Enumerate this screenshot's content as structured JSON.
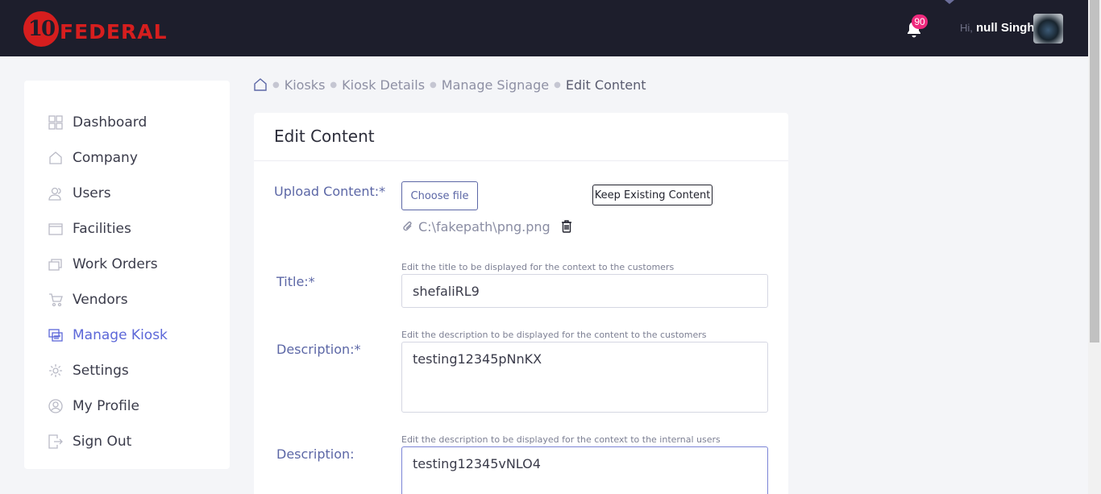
{
  "header": {
    "logo_number": "10",
    "logo_text": "FEDERAL",
    "notification_count": "90",
    "greeting": "Hi,",
    "user_name": "null Singh"
  },
  "sidebar": {
    "items": [
      {
        "label": "Dashboard",
        "icon": "dashboard-icon"
      },
      {
        "label": "Company",
        "icon": "home-icon"
      },
      {
        "label": "Users",
        "icon": "users-icon"
      },
      {
        "label": "Facilities",
        "icon": "facilities-icon"
      },
      {
        "label": "Work Orders",
        "icon": "work-orders-icon"
      },
      {
        "label": "Vendors",
        "icon": "cart-icon"
      },
      {
        "label": "Manage Kiosk",
        "icon": "kiosk-icon",
        "active": true
      },
      {
        "label": "Settings",
        "icon": "gear-icon"
      },
      {
        "label": "My Profile",
        "icon": "profile-icon"
      },
      {
        "label": "Sign Out",
        "icon": "sign-out-icon"
      }
    ]
  },
  "breadcrumb": [
    "Kiosks",
    "Kiosk Details",
    "Manage Signage",
    "Edit Content"
  ],
  "form": {
    "title": "Edit Content",
    "upload_label": "Upload Content:*",
    "choose_file_label": "Choose file",
    "keep_existing_label": "Keep Existing Content",
    "file_path": "C:\\fakepath\\png.png",
    "title_label": "Title:*",
    "title_hint": "Edit the title to be displayed for the context to the customers",
    "title_value": "shefaliRL9",
    "desc_label": "Description:*",
    "desc_hint": "Edit the description to be displayed for the content to the customers",
    "desc_value": "testing12345pNnKX",
    "internal_desc_label": "Description:",
    "internal_desc_hint": "Edit the description to be displayed for the context to the internal users",
    "internal_desc_value": "testing12345vNLO4"
  },
  "colors": {
    "topbar": "#1d1e2c",
    "accent": "#5c67d8",
    "brand_red": "#d61e1e",
    "badge": "#ef2a7d"
  }
}
